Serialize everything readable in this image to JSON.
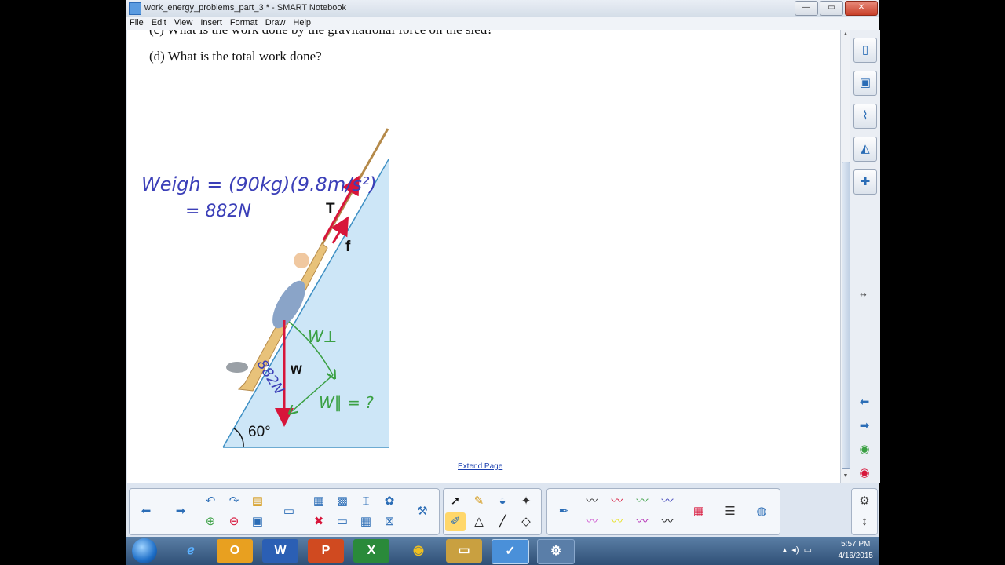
{
  "window": {
    "title": "work_energy_problems_part_3 * - SMART Notebook",
    "minimize": "—",
    "maximize": "▭",
    "close": "✕"
  },
  "menu": [
    "File",
    "Edit",
    "View",
    "Insert",
    "Format",
    "Draw",
    "Help"
  ],
  "page": {
    "previous_question": "(c) What is the work done by the gravitational force on the sled?",
    "question": "(d) What is the total work done?",
    "extend_link": "Extend Page"
  },
  "diagram": {
    "angle_label": "60°",
    "tension_label": "T",
    "friction_label": "f",
    "weight_label": "w"
  },
  "handwriting": {
    "weight_line1": "Weigh = (90kg)(9.8m/s²)",
    "weight_line2": "= 882N",
    "w_perp": "W⊥",
    "w_parallel": "W∥ = ?",
    "weight_on_arrow": "882N"
  },
  "side_tabs": [
    "page-sorter-icon",
    "gallery-icon",
    "attachments-icon",
    "properties-icon",
    "addons-icon"
  ],
  "taskbar": {
    "time": "5:57 PM",
    "date": "4/16/2015",
    "apps": [
      "ie-icon",
      "outlook-icon",
      "word-icon",
      "powerpoint-icon",
      "excel-icon",
      "chrome-icon",
      "explorer-icon",
      "notebook-icon",
      "smart-tools-icon"
    ]
  },
  "colors": {
    "red_arrow": "#d7153a",
    "ink_blue": "#3b3fb8",
    "ink_green": "#3aa043",
    "slope_blue": "#cde6f7"
  }
}
